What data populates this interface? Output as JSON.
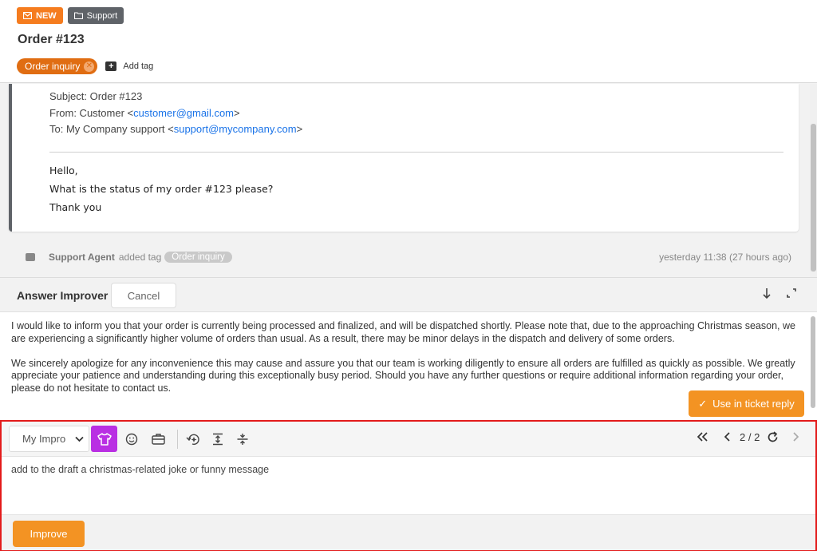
{
  "header": {
    "badge_new": "NEW",
    "badge_folder": "Support",
    "title": "Order #123",
    "tag": "Order inquiry",
    "add_tag": "Add tag"
  },
  "email": {
    "subject_line": "Subject: Order #123",
    "from_prefix": "From: Customer <",
    "from_email": "customer@gmail.com",
    "from_suffix": ">",
    "to_prefix": "To: My Company support <",
    "to_email": "support@mycompany.com",
    "to_suffix": ">",
    "body_lines": [
      "Hello,",
      "What is the status of my order #123 please?",
      "Thank you"
    ]
  },
  "activity": {
    "agent": "Support Agent",
    "action": "added tag",
    "tag": "Order inquiry",
    "time": "yesterday 11:38 (27 hours ago)"
  },
  "improver": {
    "title": "Answer Improver",
    "cancel_label": "Cancel",
    "draft_paragraphs": [
      "I would like to inform you that your order is currently being processed and finalized, and will be dispatched shortly. Please note that, due to the approaching Christmas season, we are experiencing a significantly higher volume of orders than usual. As a result, there may be minor delays in the dispatch and delivery of some orders.",
      "We sincerely apologize for any inconvenience this may cause and assure you that our team is working diligently to ensure all orders are fulfilled as quickly as possible. We greatly appreciate your patience and understanding during this exceptionally busy period. Should you have any further questions or require additional information regarding your order, please do not hesitate to contact us."
    ],
    "use_reply_label": "Use in ticket reply",
    "select_value": "My Impro",
    "pager": "2 / 2",
    "prompt": "add to the draft a christmas-related joke or funny message",
    "improve_label": "Improve"
  },
  "colors": {
    "accent_orange": "#f39323",
    "tag_orange": "#e06d12",
    "active_purple": "#b92fe3",
    "highlight_red": "#e31b1b",
    "link_blue": "#1a73e8"
  }
}
